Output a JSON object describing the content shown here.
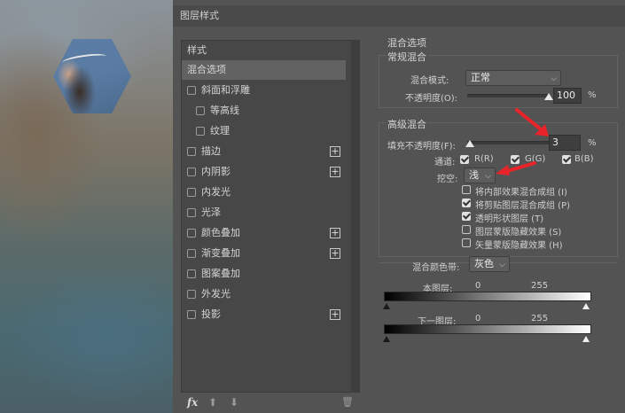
{
  "dialog": {
    "title": "图层样式"
  },
  "left_panel": {
    "header": "样式",
    "items": [
      {
        "label": "混合选项",
        "checkbox": false,
        "plus": false,
        "selected": true,
        "indent": 0
      },
      {
        "label": "斜面和浮雕",
        "checkbox": true,
        "plus": false,
        "selected": false,
        "indent": 0
      },
      {
        "label": "等高线",
        "checkbox": true,
        "plus": false,
        "selected": false,
        "indent": 1
      },
      {
        "label": "纹理",
        "checkbox": true,
        "plus": false,
        "selected": false,
        "indent": 1
      },
      {
        "label": "描边",
        "checkbox": true,
        "plus": true,
        "selected": false,
        "indent": 0
      },
      {
        "label": "内阴影",
        "checkbox": true,
        "plus": true,
        "selected": false,
        "indent": 0
      },
      {
        "label": "内发光",
        "checkbox": true,
        "plus": false,
        "selected": false,
        "indent": 0
      },
      {
        "label": "光泽",
        "checkbox": true,
        "plus": false,
        "selected": false,
        "indent": 0
      },
      {
        "label": "颜色叠加",
        "checkbox": true,
        "plus": true,
        "selected": false,
        "indent": 0
      },
      {
        "label": "渐变叠加",
        "checkbox": true,
        "plus": true,
        "selected": false,
        "indent": 0
      },
      {
        "label": "图案叠加",
        "checkbox": true,
        "plus": false,
        "selected": false,
        "indent": 0
      },
      {
        "label": "外发光",
        "checkbox": true,
        "plus": false,
        "selected": false,
        "indent": 0
      },
      {
        "label": "投影",
        "checkbox": true,
        "plus": true,
        "selected": false,
        "indent": 0
      }
    ],
    "bottom": {
      "fx": "fx",
      "up": "⬆",
      "down": "⬇",
      "trash": "🗑"
    }
  },
  "blend": {
    "title": "混合选项",
    "general": {
      "title": "常规混合",
      "mode_label": "混合模式:",
      "mode_value": "正常",
      "opacity_label": "不透明度(O):",
      "opacity_value": "100",
      "opacity_unit": "%",
      "opacity_level": 1.0
    },
    "advanced": {
      "title": "高级混合",
      "fill_label": "填充不透明度(F):",
      "fill_value": "3",
      "fill_unit": "%",
      "fill_level": 0.03,
      "channels_label": "通道:",
      "channel_r": "R(R)",
      "channel_g": "G(G)",
      "channel_b": "B(B)",
      "knockout_label": "挖空:",
      "knockout_value": "浅",
      "options": [
        {
          "label": "将内部效果混合成组 (I)",
          "checked": false
        },
        {
          "label": "将剪贴图层混合成组 (P)",
          "checked": true
        },
        {
          "label": "透明形状图层 (T)",
          "checked": true
        },
        {
          "label": "图层蒙版隐藏效果 (S)",
          "checked": false
        },
        {
          "label": "矢量蒙版隐藏效果 (H)",
          "checked": false
        }
      ]
    },
    "blend_if": {
      "label": "混合颜色带:",
      "value": "灰色",
      "this_layer_label": "本图层:",
      "this_min": "0",
      "this_max": "255",
      "underlying_label": "下一图层:",
      "under_min": "0",
      "under_max": "255"
    }
  },
  "colors": {
    "arrow": "#e8242a",
    "dialog_bg": "#535353"
  }
}
